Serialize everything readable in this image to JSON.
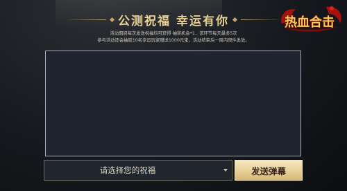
{
  "header": {
    "title": "公测祝福 幸运有你",
    "desc_line1": "活动期间每次发送祝福均可获得 抽奖机会*1，该环节每天最多5次",
    "desc_line2": "参与活动还会抽取10名幸运玩家赠送1000元宝，活动结束后一周内邮件发放。"
  },
  "logo": {
    "text": "热血合击"
  },
  "form": {
    "select_value": "请选择您的祝福",
    "send_label": "发送弹幕"
  },
  "colors": {
    "title": "#e7cf95",
    "button_bg": "#e7cf98",
    "box_bg": "#1f2430",
    "box_border": "#b7ab8d"
  }
}
